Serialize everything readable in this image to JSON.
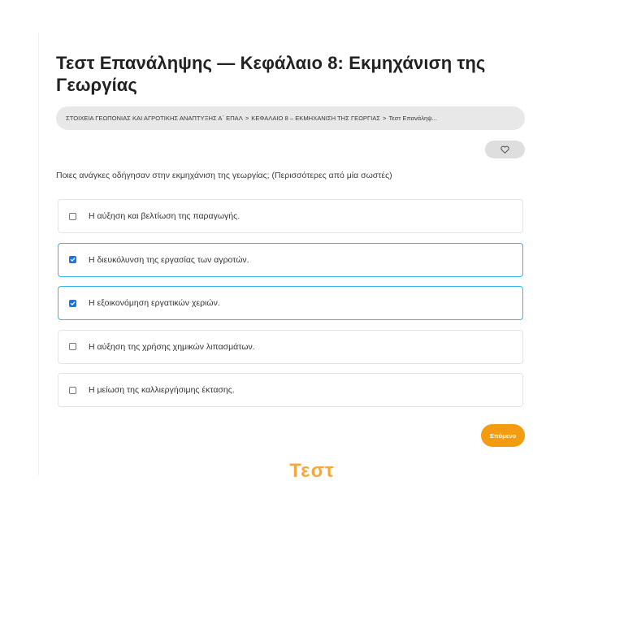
{
  "page": {
    "title": "Τεστ Επανάληψης — Κεφάλαιο 8: Εκμηχάνιση της Γεωργίας"
  },
  "breadcrumb": {
    "items": [
      "ΣΤΟΙΧΕΙΑ ΓΕΩΠΟΝΙΑΣ ΚΑΙ ΑΓΡΟΤΙΚΗΣ ΑΝΑΠΤΥΞΗΣ Α΄ ΕΠΑΛ",
      "ΚΕΦΑΛΑΙΟ 8 – ΕΚΜΗΧΑΝΙΣΗ ΤΗΣ ΓΕΩΡΓΙΑΣ",
      "Τεστ Επανάληψ..."
    ],
    "separator": ">"
  },
  "favorite": {
    "icon": "heart-outline-icon"
  },
  "quiz": {
    "question": "Ποιες ανάγκες οδήγησαν στην εκμηχάνιση της γεωργίας; (Περισσότερες από μία σωστές)",
    "options": [
      {
        "label": "Η αύξηση και βελτίωση της παραγωγής.",
        "checked": false
      },
      {
        "label": "Η διευκόλυνση της εργασίας των αγροτών.",
        "checked": true
      },
      {
        "label": "Η εξοικονόμηση εργατικών χεριών.",
        "checked": true
      },
      {
        "label": "Η αύξηση της χρήσης χημικών λιπασμάτων.",
        "checked": false
      },
      {
        "label": "Η μείωση της καλλιεργήσιμης έκτασης.",
        "checked": false
      }
    ],
    "next_label": "Επόμενο"
  },
  "brand": {
    "logo_text": "Τεστ"
  },
  "colors": {
    "accent": "#f39c12",
    "selected_border": "#36b7e8",
    "checkbox_checked": "#1a73e8",
    "logo": "#f6a93b"
  }
}
